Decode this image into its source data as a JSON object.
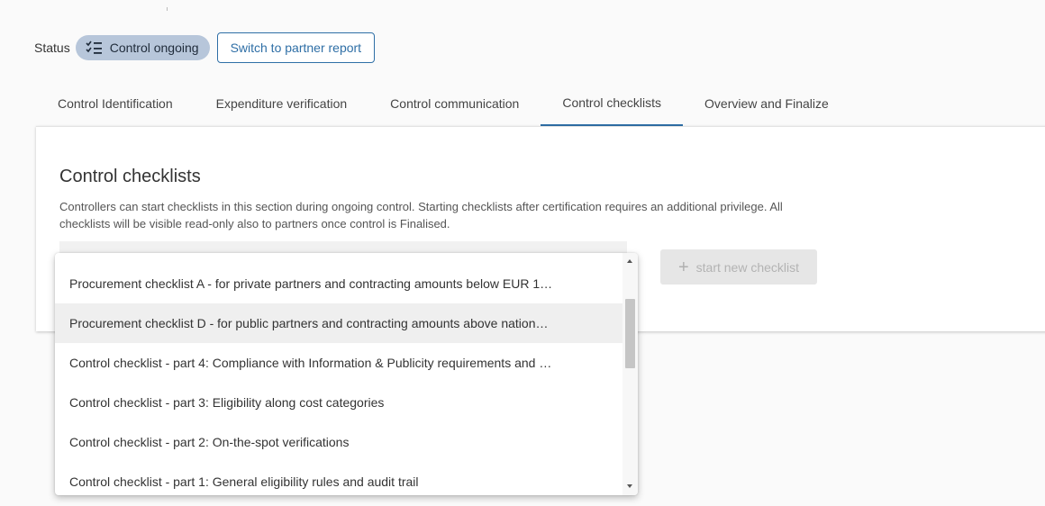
{
  "status": {
    "label": "Status",
    "chip_text": "Control ongoing",
    "chip_icon": "checklist-icon",
    "switch_button": "Switch to partner report"
  },
  "tabs": [
    {
      "label": "Control Identification",
      "active": false
    },
    {
      "label": "Expenditure verification",
      "active": false
    },
    {
      "label": "Control communication",
      "active": false
    },
    {
      "label": "Control checklists",
      "active": true
    },
    {
      "label": "Overview and Finalize",
      "active": false
    }
  ],
  "section": {
    "title": "Control checklists",
    "description": "Controllers can start checklists in this section during ongoing control. Starting checklists after certification requires an additional privilege. All checklists will be visible read-only also to partners once control is Finalised.",
    "start_button": "start new checklist",
    "start_button_icon": "plus-icon"
  },
  "dropdown": {
    "options": [
      "Procurement checklist A - for private partners and contracting amounts below EUR 1…",
      "Procurement checklist D - for public partners and contracting amounts above nation…",
      "Control checklist - part 4: Compliance with Information & Publicity requirements and …",
      "Control checklist - part 3: Eligibility along cost categories",
      "Control checklist - part 2: On-the-spot verifications",
      "Control checklist - part 1: General eligibility rules and audit trail"
    ],
    "hovered_index": 1
  },
  "colors": {
    "accent": "#2f6fa6",
    "chip_bg": "#b7c6da",
    "hover_bg": "#efefef"
  }
}
